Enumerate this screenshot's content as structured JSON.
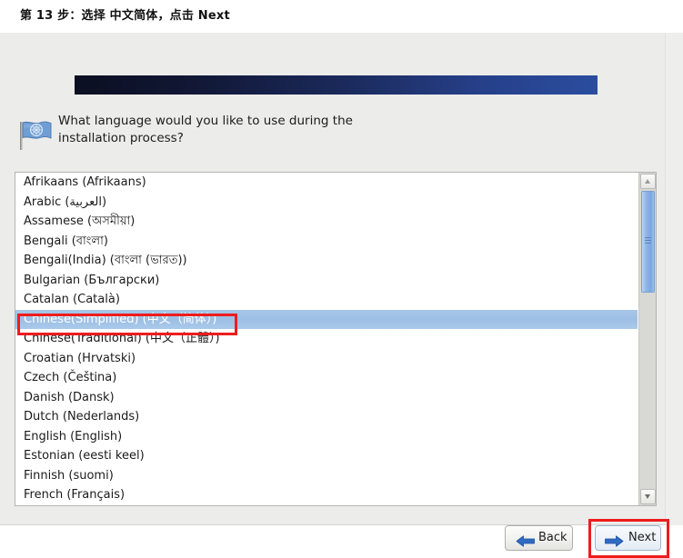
{
  "caption": {
    "text": "第 13 步：选择 中文简体，点击 Next"
  },
  "installer": {
    "prompt": {
      "icon": "un-flag-icon",
      "line1": "What language would you like to use during the",
      "line2": "installation process?"
    },
    "language_list": {
      "selected": "Chinese(Simplified) (中文（简体）)",
      "items": [
        "Afrikaans (Afrikaans)",
        "Arabic (العربية)",
        "Assamese (অসমীয়া)",
        "Bengali (বাংলা)",
        "Bengali(India) (বাংলা (ভারত))",
        "Bulgarian (Български)",
        "Catalan (Català)",
        "Chinese(Simplified) (中文（简体）)",
        "Chinese(Traditional) (中文（正體）)",
        "Croatian (Hrvatski)",
        "Czech (Čeština)",
        "Danish (Dansk)",
        "Dutch (Nederlands)",
        "English (English)",
        "Estonian (eesti keel)",
        "Finnish (suomi)",
        "French (Français)"
      ],
      "scrollbar": {
        "up_icon": "chevron-up-icon",
        "down_icon": "chevron-down-icon"
      }
    },
    "footer": {
      "back_label": "Back",
      "back_icon": "arrow-left-icon",
      "next_label": "Next",
      "next_icon": "arrow-right-icon"
    }
  },
  "colors": {
    "banner_dark": "#0b0f22",
    "banner_light": "#2b4d9e",
    "selection": "#9dbfe4",
    "annotation": "#ee1c1c",
    "dialog_bg": "#ececeb"
  }
}
